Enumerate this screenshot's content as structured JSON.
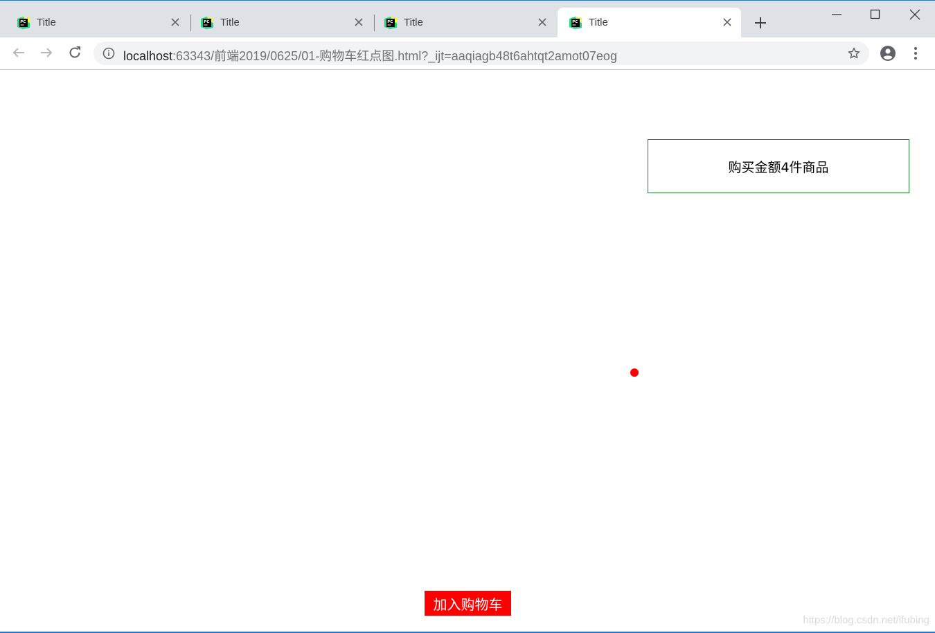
{
  "browser": {
    "tabs": [
      {
        "title": "Title",
        "active": false
      },
      {
        "title": "Title",
        "active": false
      },
      {
        "title": "Title",
        "active": false
      },
      {
        "title": "Title",
        "active": true
      }
    ],
    "address": {
      "host": "localhost",
      "rest": ":63343/前端2019/0625/01-购物车红点图.html?_ijt=aaqiagb48t6ahtqt2amot07eog"
    }
  },
  "page": {
    "cart_summary": "购买金额4件商品",
    "add_to_cart_label": "加入购物车",
    "watermark": "https://blog.csdn.net/lfubing"
  },
  "colors": {
    "accent_red": "#ff0000",
    "cart_border": "#1b7a2c",
    "tabstrip_bg": "#dee1e6"
  },
  "icons": [
    "pycharm-favicon-icon",
    "close-icon",
    "plus-icon",
    "minimize-icon",
    "maximize-icon",
    "window-close-icon",
    "back-arrow-icon",
    "forward-arrow-icon",
    "reload-icon",
    "info-icon",
    "star-icon",
    "profile-icon",
    "kebab-menu-icon"
  ]
}
